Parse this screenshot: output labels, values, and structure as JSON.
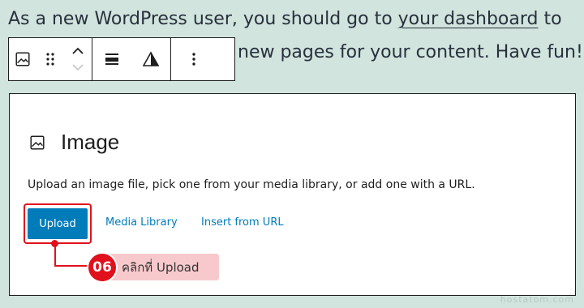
{
  "paragraph": {
    "line1_before": "As a new WordPress user, you should go to ",
    "line1_link": "your dashboard",
    "line1_after": " to",
    "line2": "new pages for your content. Have fun!"
  },
  "image_block": {
    "title": "Image",
    "instructions": "Upload an image file, pick one from your media library, or add one with a URL.",
    "upload_label": "Upload",
    "media_library_label": "Media Library",
    "insert_url_label": "Insert from URL"
  },
  "callout": {
    "step_number": "06",
    "text": "คลิกที่ Upload"
  },
  "watermark": "hostatom.com",
  "colors": {
    "background": "#d1e4dd",
    "accent_blue": "#007cba",
    "callout_red": "#e0111c",
    "callout_pink": "#f8c9cc"
  },
  "icons": {
    "toolbar": [
      "image-icon",
      "drag-handle-icon",
      "move-up-icon",
      "move-down-icon",
      "align-icon",
      "warning-triangle-icon",
      "more-options-icon"
    ],
    "block_title": "image-icon"
  }
}
